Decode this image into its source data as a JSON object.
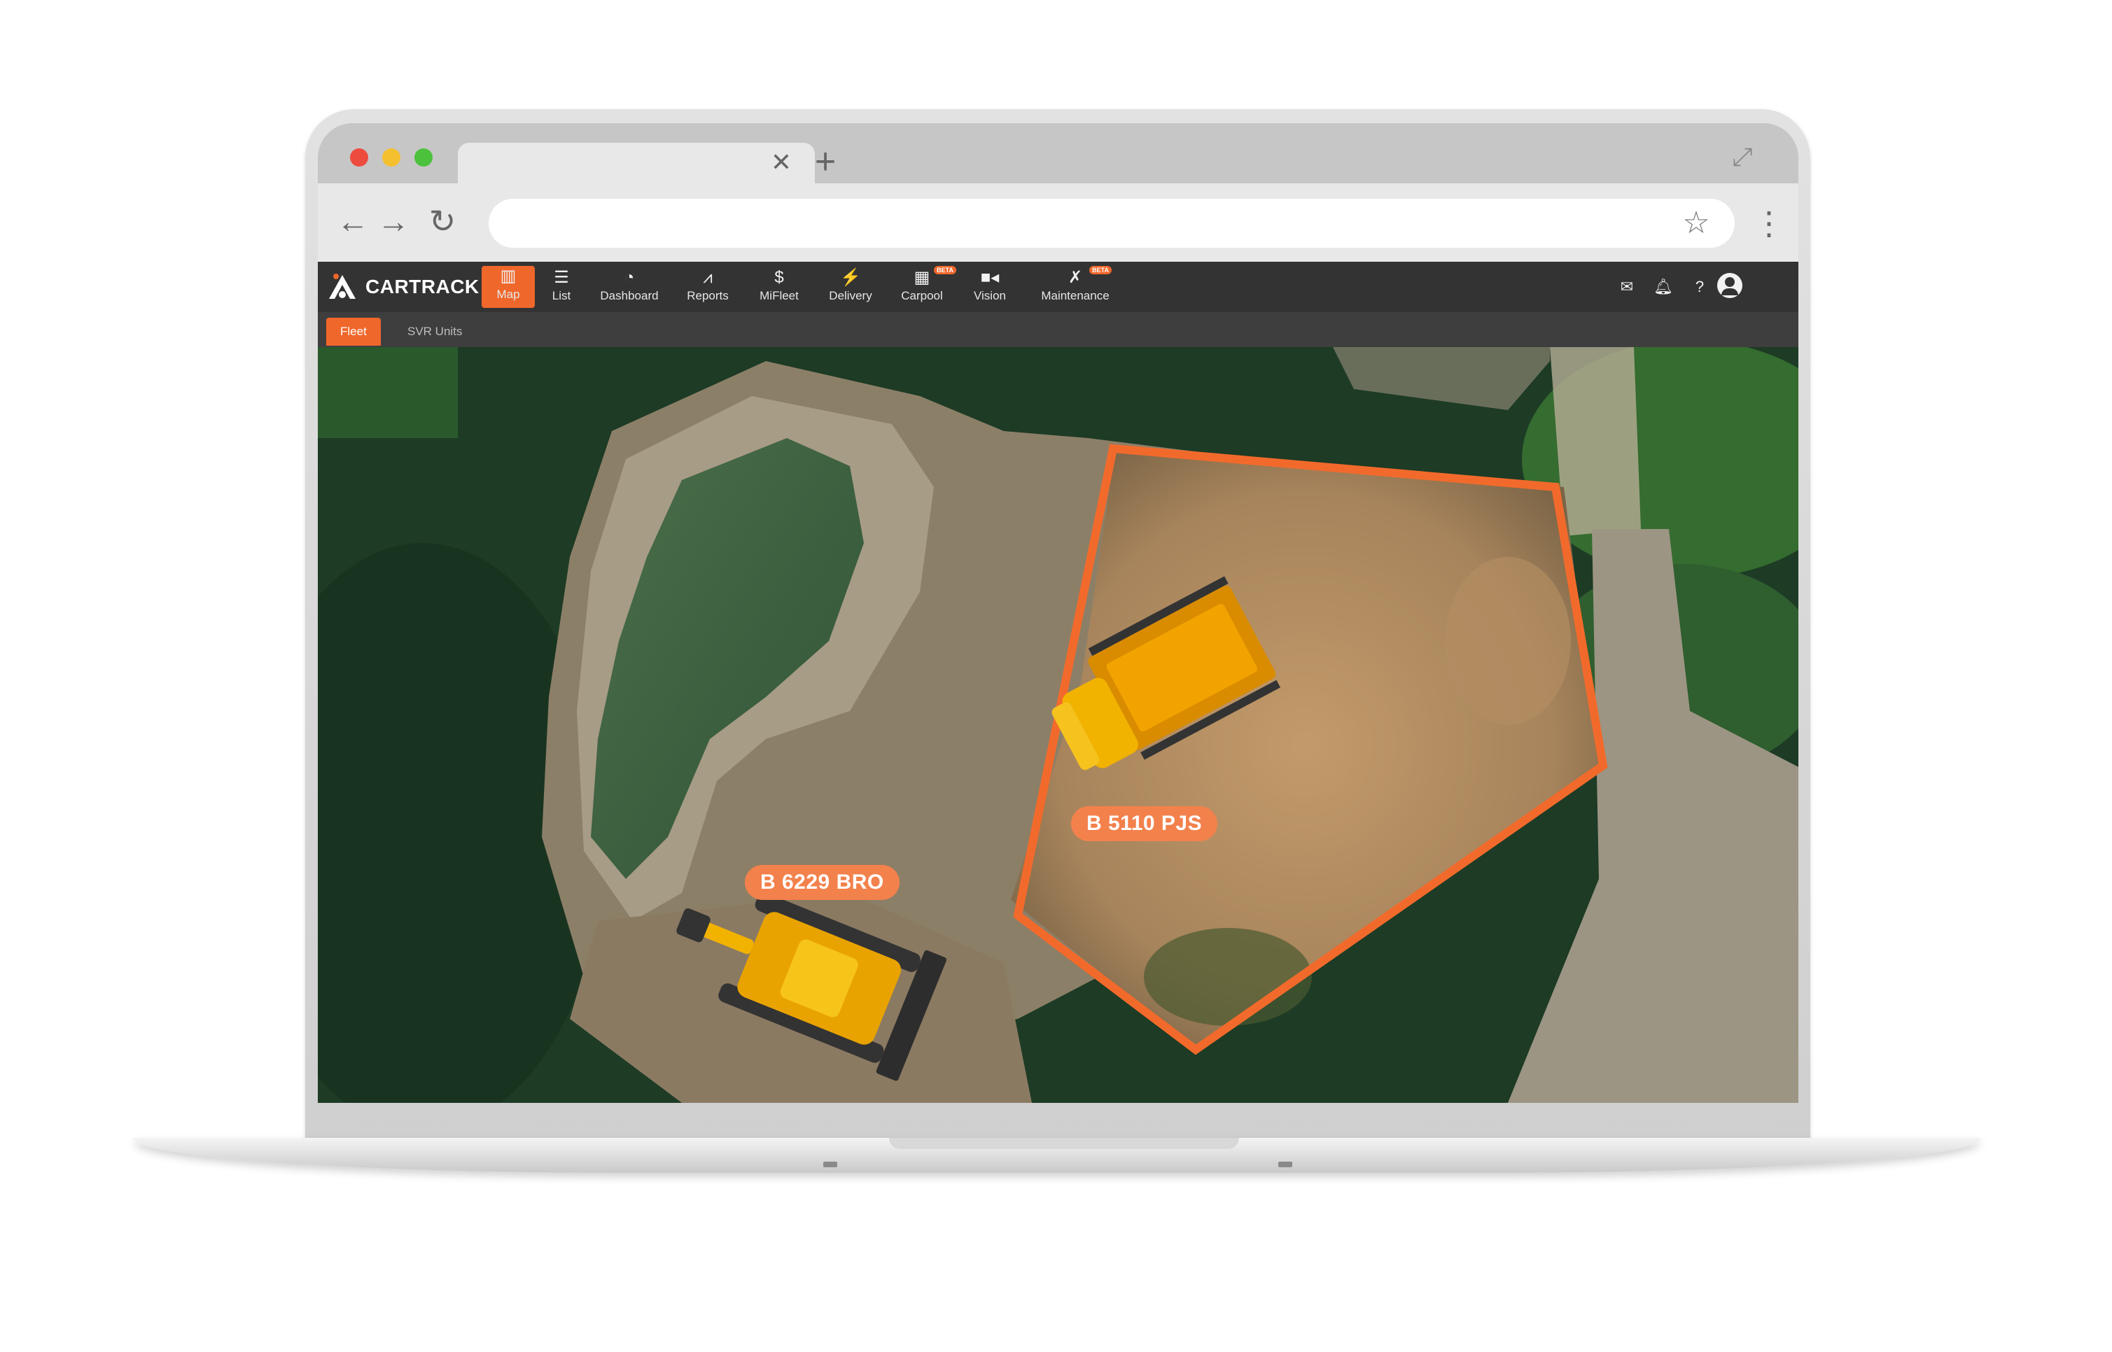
{
  "app": {
    "brand": "CARTRACK",
    "nav": [
      {
        "id": "map",
        "label": "Map",
        "icon": "map-icon",
        "active": true
      },
      {
        "id": "list",
        "label": "List",
        "icon": "list-icon"
      },
      {
        "id": "dashboard",
        "label": "Dashboard",
        "icon": "gauge-icon"
      },
      {
        "id": "reports",
        "label": "Reports",
        "icon": "chart-icon"
      },
      {
        "id": "mifleet",
        "label": "MiFleet",
        "icon": "dollar-icon"
      },
      {
        "id": "delivery",
        "label": "Delivery",
        "icon": "bolt-icon"
      },
      {
        "id": "carpool",
        "label": "Carpool",
        "icon": "calendar-icon",
        "badge": "BETA"
      },
      {
        "id": "vision",
        "label": "Vision",
        "icon": "video-icon"
      },
      {
        "id": "maintenance",
        "label": "Maintenance",
        "icon": "tools-icon",
        "badge": "BETA"
      }
    ],
    "subtabs": [
      {
        "label": "Fleet",
        "active": true
      },
      {
        "label": "SVR Units"
      }
    ],
    "accent": "#f0672b"
  },
  "map": {
    "vehicles": [
      {
        "plate": "B 5110 PJS",
        "type": "dump-truck"
      },
      {
        "plate": "B 6229 BRO",
        "type": "bulldozer"
      }
    ],
    "geofence_color": "#f26a2b"
  }
}
